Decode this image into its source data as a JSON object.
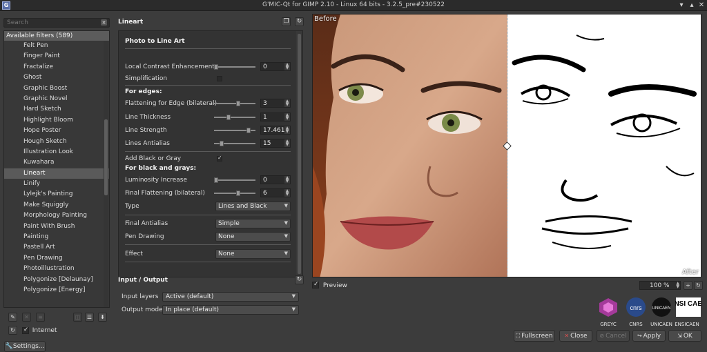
{
  "window": {
    "title": "G'MIC-Qt for GIMP 2.10 - Linux 64 bits - 3.2.5_pre#230522",
    "app_icon": "G"
  },
  "search": {
    "placeholder": "Search"
  },
  "filters": {
    "header": "Available filters (589)",
    "items": [
      "Felt Pen",
      "Finger Paint",
      "Fractalize",
      "Ghost",
      "Graphic Boost",
      "Graphic Novel",
      "Hard Sketch",
      "Highlight Bloom",
      "Hope Poster",
      "Hough Sketch",
      "Illustration Look",
      "Kuwahara",
      "Lineart",
      "Linify",
      "Lylejk's Painting",
      "Make Squiggly",
      "Morphology Painting",
      "Paint With Brush",
      "Painting",
      "Pastell Art",
      "Pen Drawing",
      "Photoillustration",
      "Polygonize [Delaunay]",
      "Polygonize [Energy]"
    ],
    "selected": "Lineart"
  },
  "internet": {
    "label": "Internet",
    "checked": true
  },
  "settings_label": "Settings...",
  "filter": {
    "title": "Lineart",
    "subtitle": "Photo to Line Art",
    "params": {
      "local_contrast": {
        "label": "Local Contrast Enhancement",
        "value": "0",
        "fraction": 0.0
      },
      "simplification": {
        "label": "Simplification",
        "checked": false
      },
      "edges_header": "For edges:",
      "flattening_edge": {
        "label": "Flattening for Edge (bilateral)",
        "value": "3",
        "fraction": 0.6
      },
      "line_thickness": {
        "label": "Line Thickness",
        "value": "1",
        "fraction": 0.33
      },
      "line_strength": {
        "label": "Line Strength",
        "value": "17.461",
        "fraction": 0.87
      },
      "lines_antialias": {
        "label": "Lines Antialias",
        "value": "15",
        "fraction": 0.15
      },
      "add_black_gray": {
        "label": "Add Black or Gray",
        "checked": true
      },
      "black_grays_header": "For black and grays:",
      "luminosity": {
        "label": "Luminosity Increase",
        "value": "0",
        "fraction": 0.0
      },
      "final_flattening": {
        "label": "Final Flattening (bilateral)",
        "value": "6",
        "fraction": 0.6
      },
      "type": {
        "label": "Type",
        "value": "Lines and Black"
      },
      "final_antialias": {
        "label": "Final Antialias",
        "value": "Simple"
      },
      "pen_drawing": {
        "label": "Pen Drawing",
        "value": "None"
      },
      "effect": {
        "label": "Effect",
        "value": "None"
      }
    }
  },
  "io": {
    "title": "Input / Output",
    "input_layers": {
      "label": "Input layers",
      "value": "Active (default)"
    },
    "output_mode": {
      "label": "Output mode",
      "value": "In place (default)"
    }
  },
  "preview": {
    "before_label": "Before",
    "after_label": "After",
    "checkbox_label": "Preview",
    "checked": true,
    "zoom": "100 %"
  },
  "logos": [
    "GREYC",
    "CNRS",
    "UNICAEN",
    "ENSICAEN"
  ],
  "logo_text": {
    "cnrs": "cnrs",
    "unicaen": "UNICAEN",
    "ensicaen": "ENSI CAEN"
  },
  "buttons": {
    "fullscreen": "Fullscreen",
    "close": "Close",
    "cancel": "Cancel",
    "apply": "Apply",
    "ok": "OK"
  },
  "colors": {
    "panel": "#3c3c3c",
    "selection": "#5a5a5a",
    "header": "#5c5c5c"
  }
}
